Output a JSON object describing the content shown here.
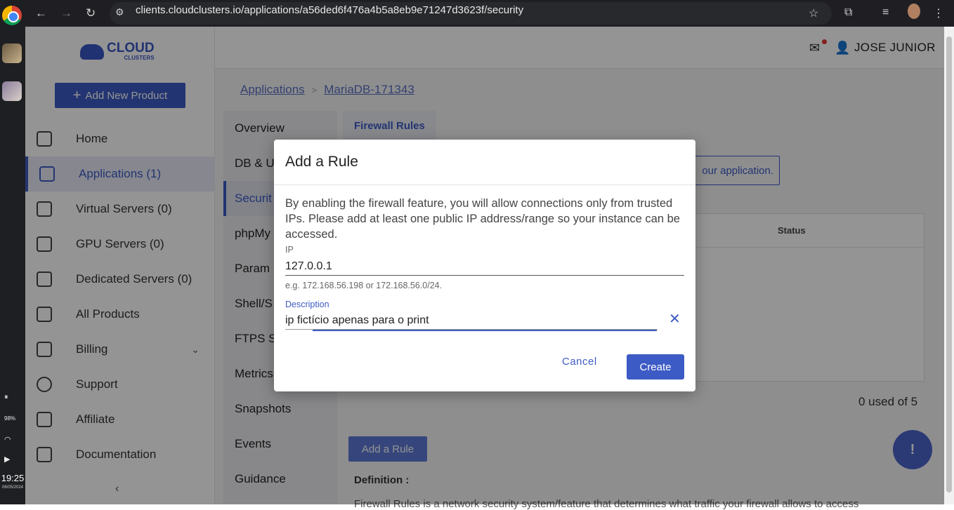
{
  "browser": {
    "url": "clients.cloudclusters.io/applications/a56ded6f476a4b5a8eb9e71247d3623f/security"
  },
  "os": {
    "time": "19:25",
    "date": "06/05/2024",
    "battery": "98%"
  },
  "logo": {
    "line1": "CLOUD",
    "line2": "CLUSTERS"
  },
  "sidebar": {
    "add_button": "Add New Product",
    "items": [
      {
        "label": "Home",
        "icon": "home-icon"
      },
      {
        "label": "Applications (1)",
        "icon": "grid-icon",
        "active": true
      },
      {
        "label": "Virtual Servers (0)",
        "icon": "server-icon"
      },
      {
        "label": "GPU Servers (0)",
        "icon": "chip-icon"
      },
      {
        "label": "Dedicated Servers (0)",
        "icon": "layers-icon"
      },
      {
        "label": "All Products",
        "icon": "box-icon"
      },
      {
        "label": "Billing",
        "icon": "billing-icon"
      },
      {
        "label": "Support",
        "icon": "support-icon"
      },
      {
        "label": "Affiliate",
        "icon": "affiliate-icon"
      },
      {
        "label": "Documentation",
        "icon": "document-icon"
      }
    ]
  },
  "header": {
    "user_name": "JOSE JUNIOR"
  },
  "breadcrumb": {
    "root": "Applications",
    "current": "MariaDB-171343",
    "separator": ">"
  },
  "subnav": {
    "items": [
      {
        "label": "Overview"
      },
      {
        "label": "DB & U"
      },
      {
        "label": "Securit",
        "active": true
      },
      {
        "label": "phpMy"
      },
      {
        "label": "Param"
      },
      {
        "label": "Shell/S"
      },
      {
        "label": "FTPS S"
      },
      {
        "label": "Metrics"
      },
      {
        "label": "Snapshots"
      },
      {
        "label": "Events"
      },
      {
        "label": "Guidance"
      }
    ]
  },
  "content": {
    "tab": "Firewall Rules",
    "notice_tail": "our application.",
    "table_header_status": "Status",
    "used": "0 used of 5",
    "add_rule_button": "Add a Rule",
    "definition_title": "Definition :",
    "definition_text": "Firewall Rules is a network security system/feature that determines what traffic your firewall allows to access"
  },
  "modal": {
    "title": "Add a Rule",
    "text": "By enabling the firewall feature, you will allow connections only from trusted IPs. Please add at least one public IP address/range so your instance can be accessed.",
    "ip_label": "IP",
    "ip_value": "127.0.0.1",
    "ip_hint": "e.g. 172.168.56.198 or 172.168.56.0/24.",
    "description_label": "Description",
    "description_value": "ip fictício apenas para o print",
    "cancel": "Cancel",
    "create": "Create"
  }
}
